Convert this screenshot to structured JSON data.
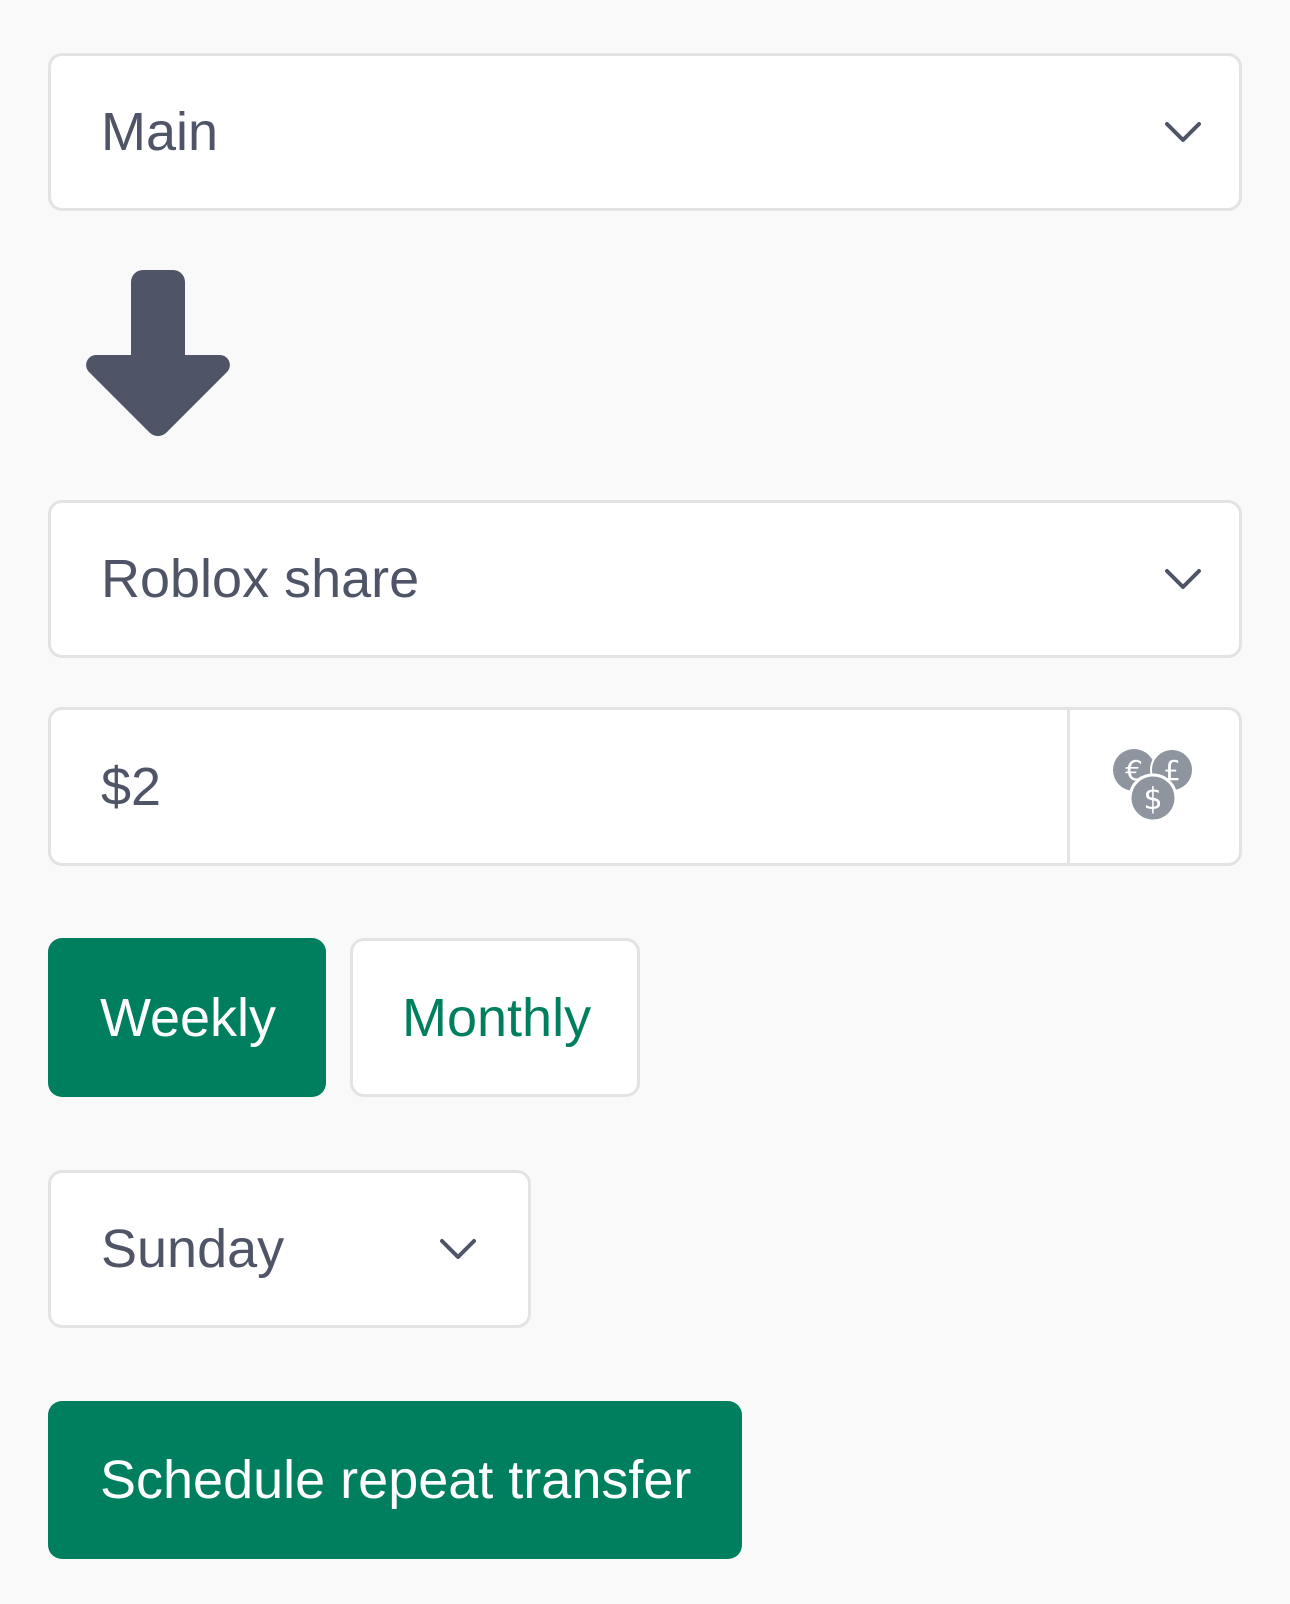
{
  "from_account": {
    "selected": "Main",
    "icon": "chevron-down-icon"
  },
  "arrow_icon": "arrow-down-icon",
  "to_account": {
    "selected": "Roblox share",
    "icon": "chevron-down-icon"
  },
  "amount": {
    "value": "$2",
    "currency_icon": "currency-exchange-icon"
  },
  "frequency": {
    "options": [
      "Weekly",
      "Monthly"
    ],
    "selected": "Weekly"
  },
  "day": {
    "selected": "Sunday",
    "icon": "chevron-down-icon"
  },
  "submit": {
    "label": "Schedule repeat transfer"
  },
  "colors": {
    "accent": "#007f5f",
    "text": "#4f5566",
    "icon_gray": "#8e959e",
    "background": "#f9f9f9",
    "border": "#e3e3e3"
  }
}
